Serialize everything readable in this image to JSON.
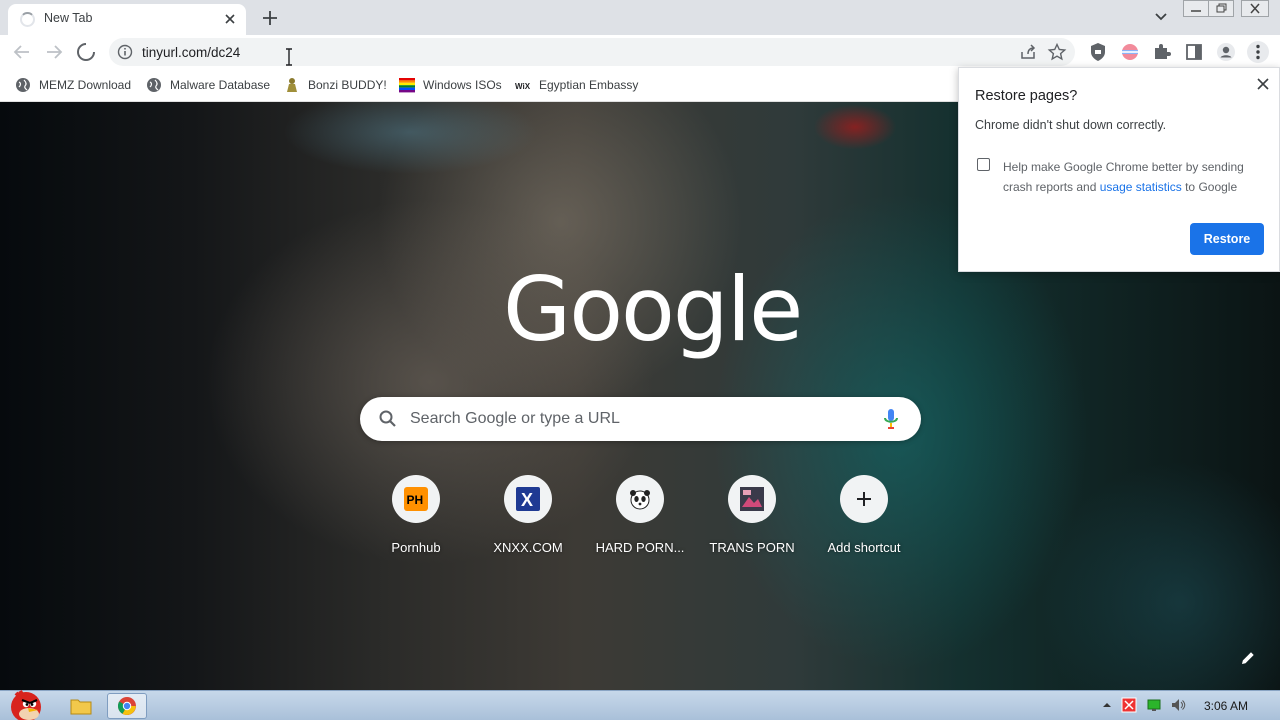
{
  "tab": {
    "title": "New Tab"
  },
  "address_bar": {
    "url": "tinyurl.com/dc24"
  },
  "bookmarks": [
    {
      "label": "MEMZ Download",
      "icon": "globe-icon"
    },
    {
      "label": "Malware Database",
      "icon": "globe-icon"
    },
    {
      "label": "Bonzi BUDDY!",
      "icon": "bonzi-icon"
    },
    {
      "label": "Windows ISOs",
      "icon": "rainbow-flag-icon"
    },
    {
      "label": "Egyptian Embassy",
      "icon": "wix-icon"
    }
  ],
  "ntp": {
    "logo": "Google",
    "search_placeholder": "Search Google or type a URL",
    "shortcuts": [
      {
        "label": "Pornhub",
        "icon": "PH"
      },
      {
        "label": "XNXX.COM",
        "icon": "X"
      },
      {
        "label": "HARD PORN...",
        "icon": "panda-icon"
      },
      {
        "label": "TRANS PORN",
        "icon": "image-icon"
      },
      {
        "label": "Add shortcut",
        "icon": "+"
      }
    ]
  },
  "restore_popup": {
    "title": "Restore pages?",
    "message": "Chrome didn't shut down correctly.",
    "checkbox_text_before": "Help make Google Chrome better by sending crash reports and ",
    "checkbox_link": "usage statistics",
    "checkbox_text_after": " to Google",
    "button": "Restore"
  },
  "taskbar": {
    "clock": "3:06 AM"
  },
  "colors": {
    "accent": "#1a73e8",
    "tabstrip": "#dee1e6"
  }
}
